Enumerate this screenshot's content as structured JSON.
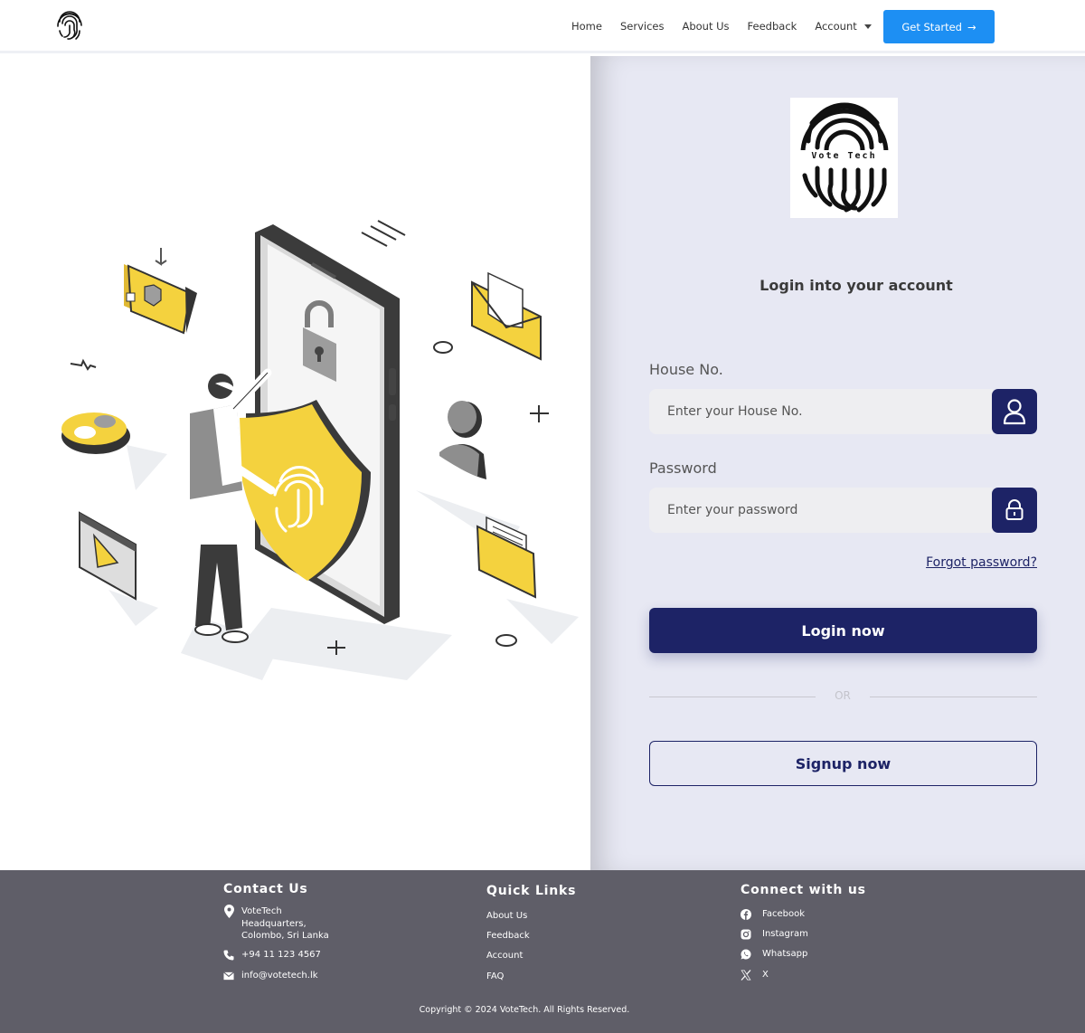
{
  "nav": {
    "links": [
      "Home",
      "Services",
      "About Us",
      "Feedback"
    ],
    "account_label": "Account",
    "cta_label": "Get Started",
    "cta_arrow": "→",
    "logo_icon": "fingerprint-icon"
  },
  "brand": {
    "text": "Vote Tech"
  },
  "login": {
    "title": "Login into your account",
    "house": {
      "label": "House No.",
      "placeholder": "Enter your House No.",
      "value": "",
      "icon": "user-icon"
    },
    "password": {
      "label": "Password",
      "placeholder": "Enter your password",
      "value": "",
      "icon": "lock-icon"
    },
    "forgot_label": "Forgot password?",
    "login_label": "Login now",
    "or_label": "OR",
    "signup_label": "Signup now"
  },
  "footer": {
    "contact": {
      "heading": "Contact Us",
      "address": "VoteTech\nHeadquarters,\nColombo, Sri Lanka",
      "phone": "+94 11 123 4567",
      "email": "info@votetech.lk"
    },
    "quick_links": {
      "heading": "Quick Links",
      "items": [
        "About Us",
        "Feedback",
        "Account",
        "FAQ"
      ]
    },
    "connect": {
      "heading": "Connect with us",
      "items": [
        "Facebook",
        "Instagram",
        "Whatsapp",
        "X"
      ]
    },
    "copyright": "Copyright © 2024 VoteTech. All Rights Reserved."
  },
  "colors": {
    "primary": "#1d2366",
    "cta": "#1d8ff3",
    "accent_yellow": "#f4d23e",
    "panel_bg": "#e7e8f3",
    "footer_bg": "#5f5e68"
  }
}
